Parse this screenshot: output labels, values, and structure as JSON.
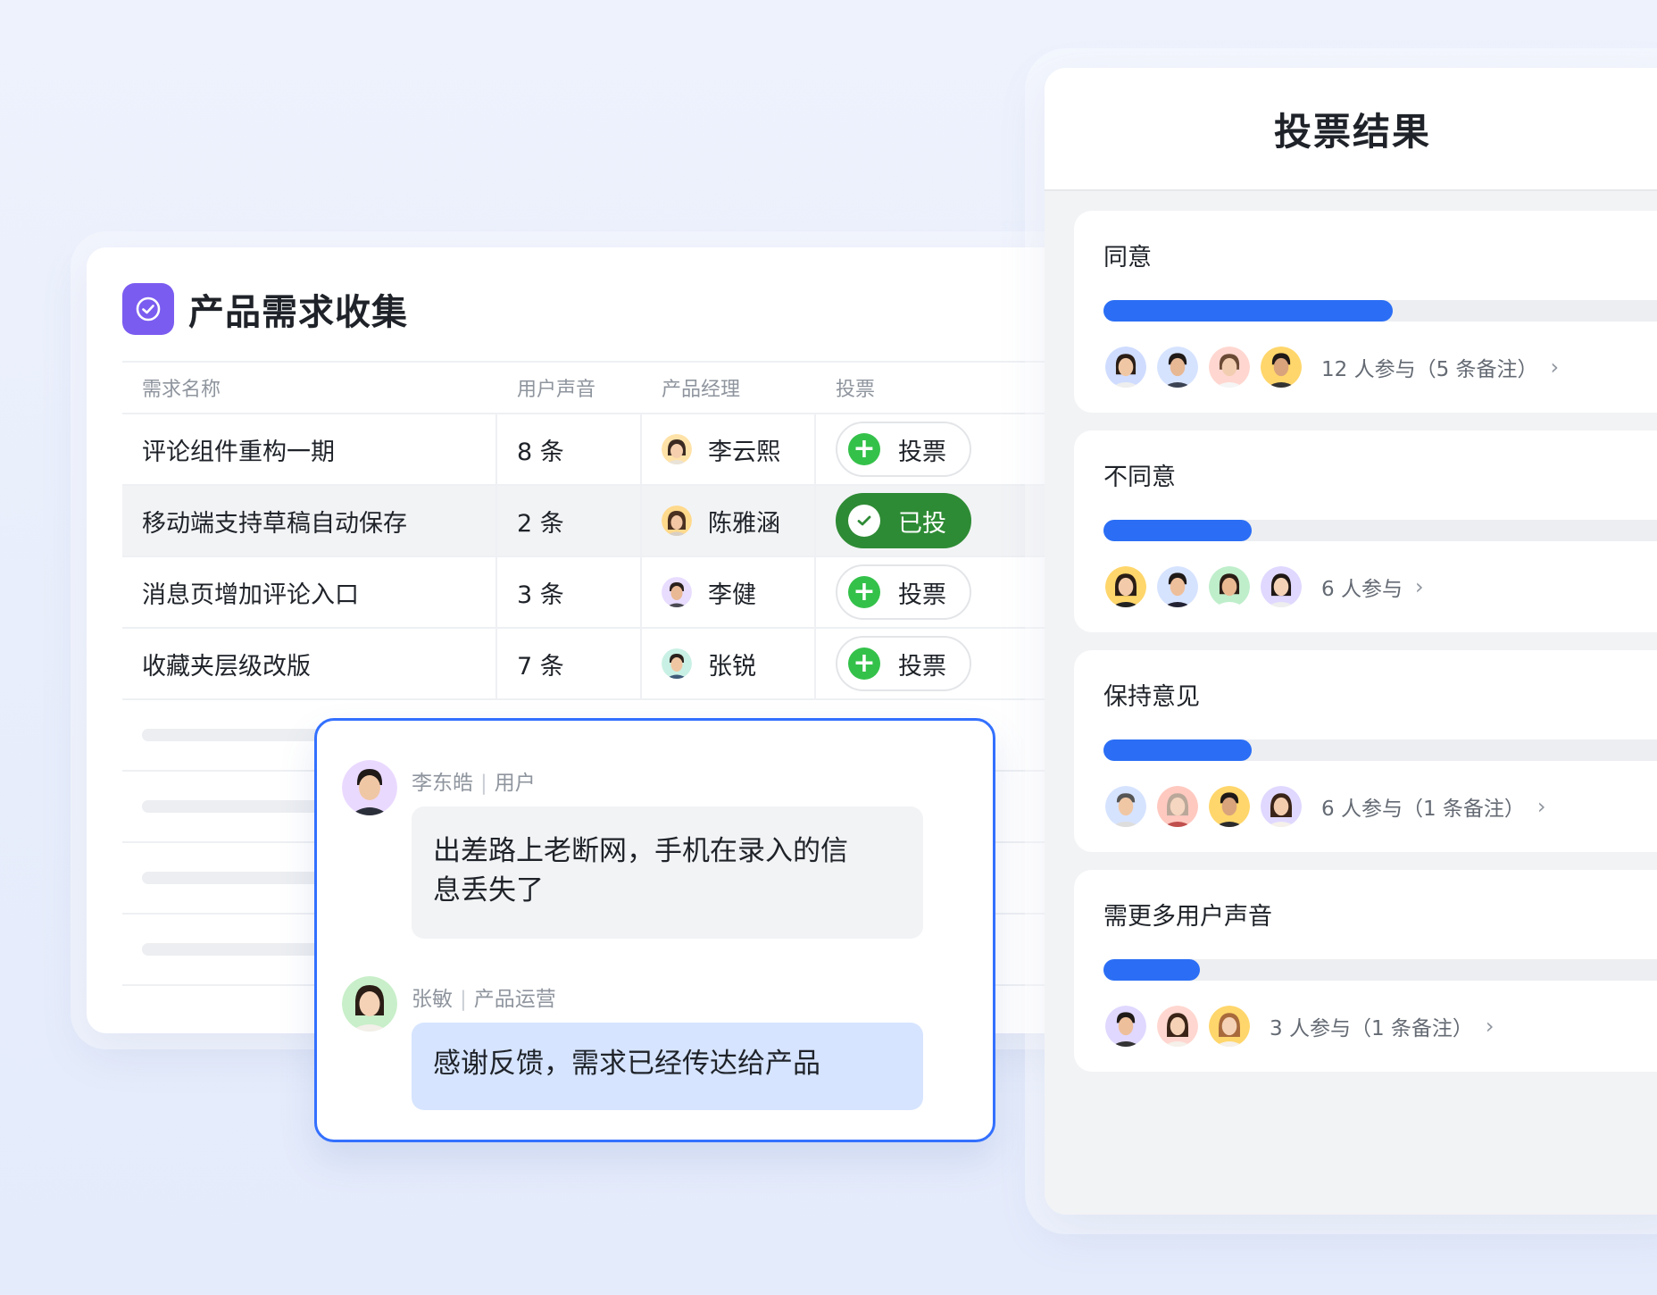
{
  "requirements_card": {
    "title": "产品需求收集",
    "columns": [
      "需求名称",
      "用户声音",
      "产品经理",
      "投票"
    ],
    "rows": [
      {
        "name": "评论组件重构一期",
        "voices": "8 条",
        "manager": "李云熙",
        "vote_label": "投票",
        "voted": false
      },
      {
        "name": "移动端支持草稿自动保存",
        "voices": "2 条",
        "manager": "陈雅涵",
        "vote_label": "已投",
        "voted": true
      },
      {
        "name": "消息页增加评论入口",
        "voices": "3 条",
        "manager": "李健",
        "vote_label": "投票",
        "voted": false
      },
      {
        "name": "收藏夹层级改版",
        "voices": "7 条",
        "manager": "张锐",
        "vote_label": "投票",
        "voted": false
      }
    ]
  },
  "comments": [
    {
      "author": "李东皓",
      "role": "用户",
      "text_line1": "出差路上老断网，手机在录入的信",
      "text_line2": "息丢失了"
    },
    {
      "author": "张敏",
      "role": "产品运营",
      "text_line1": "感谢反馈，需求已经传达给产品"
    }
  ],
  "vote_results": {
    "title": "投票结果",
    "options": [
      {
        "name": "同意",
        "summary": "12 人参与（5 条备注）",
        "fraction": 0.45
      },
      {
        "name": "不同意",
        "summary": "6 人参与",
        "fraction": 0.23
      },
      {
        "name": "保持意见",
        "summary": "6 人参与（1 条备注）",
        "fraction": 0.23
      },
      {
        "name": "需更多用户声音",
        "summary": "3 人参与（1 条备注）",
        "fraction": 0.15
      }
    ]
  },
  "colors": {
    "accent_blue": "#2b6ef5",
    "voted_green": "#2e8b35",
    "plus_green": "#34c14a",
    "app_icon_purple": "#7b5cf0",
    "popup_border": "#3370ff"
  },
  "icons": [
    "check-circle-icon",
    "plus-circle-icon",
    "chevron-right-icon"
  ]
}
